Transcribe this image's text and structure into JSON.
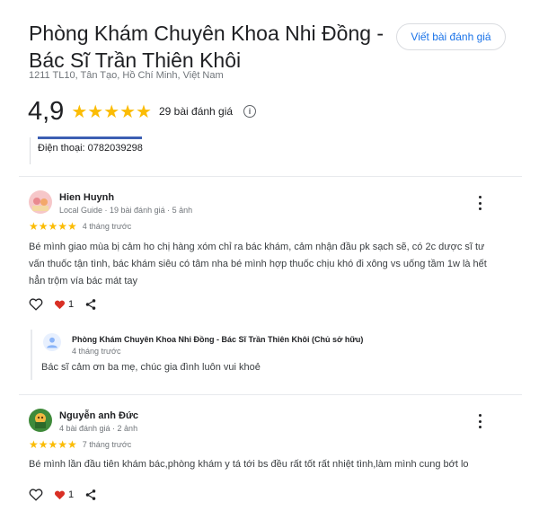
{
  "place": {
    "title": "Phòng Khám Chuyên Khoa Nhi Đồng - Bác Sĩ Trần Thiên Khôi",
    "address": "1211 TL10, Tân Tạo, Hồ Chí Minh, Việt Nam",
    "rating": "4,9",
    "stars": "★★★★★",
    "review_count": "29 bài đánh giá",
    "phone": "Điện thoại: 0782039298",
    "write_review_label": "Viết bài đánh giá",
    "info_icon": "info-icon"
  },
  "reviews": [
    {
      "name": "Hien Huynh",
      "meta": "Local Guide · 19 bài đánh giá · 5 ảnh",
      "stars": "★★★★★",
      "date": "4 tháng trước",
      "text": "Bé mình giao mùa bị cảm ho chị hàng xóm chỉ ra bác khám, cảm nhận đầu pk sạch sẽ, có 2c dược sĩ tư vấn thuốc tận tình, bác khám siêu có tâm nha bé mình hợp thuốc chịu khó đi xông vs uống tầm 1w là hết hẳn trộm vía bác mát tay",
      "likes": "1",
      "reply": {
        "name": "Phòng Khám Chuyên Khoa Nhi Đồng - Bác Sĩ Trần Thiên Khôi (Chủ sở hữu)",
        "date": "4 tháng trước",
        "text": "Bác sĩ cảm ơn ba mẹ, chúc gia đình luôn vui khoẻ"
      }
    },
    {
      "name": "Nguyễn anh Đức",
      "meta": "4 bài đánh giá · 2 ảnh",
      "stars": "★★★★★",
      "date": "7 tháng trước",
      "text": "Bé mình lần đầu tiên khám bác,phòng khám y tá tới bs đều rất tốt rất nhiệt tình,làm mình cung bớt lo",
      "likes": "1"
    }
  ],
  "colors": {
    "accent": "#1a73e8",
    "star": "#fbbc04",
    "heart": "#d93025",
    "phone_bar": "#3c5fb3"
  }
}
